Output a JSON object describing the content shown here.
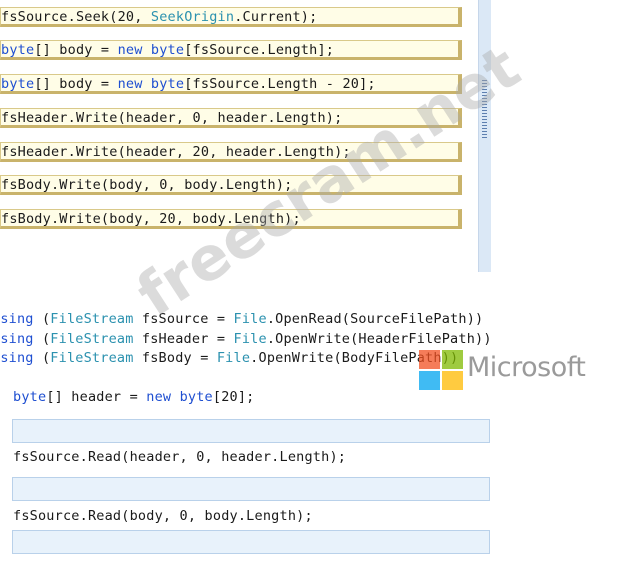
{
  "options": [
    {
      "parts": [
        [
          "t",
          "fsSource.Seek(20, "
        ],
        [
          "ty",
          "SeekOrigin"
        ],
        [
          "t",
          ".Current);"
        ]
      ]
    },
    {
      "parts": [
        [
          "kw",
          "byte"
        ],
        [
          "t",
          "[] body = "
        ],
        [
          "kw",
          "new"
        ],
        [
          "t",
          " "
        ],
        [
          "kw",
          "byte"
        ],
        [
          "t",
          "[fsSource.Length];"
        ]
      ]
    },
    {
      "parts": [
        [
          "kw",
          "byte"
        ],
        [
          "t",
          "[] body = "
        ],
        [
          "kw",
          "new"
        ],
        [
          "t",
          " "
        ],
        [
          "kw",
          "byte"
        ],
        [
          "t",
          "[fsSource.Length - 20];"
        ]
      ]
    },
    {
      "parts": [
        [
          "t",
          "fsHeader.Write(header, 0, header.Length);"
        ]
      ]
    },
    {
      "parts": [
        [
          "t",
          "fsHeader.Write(header, 20, header.Length);"
        ]
      ]
    },
    {
      "parts": [
        [
          "t",
          "fsBody.Write(body, 0, body.Length);"
        ]
      ]
    },
    {
      "parts": [
        [
          "t",
          "fsBody.Write(body, 20, body.Length);"
        ]
      ]
    }
  ],
  "code_lines": [
    {
      "parts": [
        [
          "kw",
          "using"
        ],
        [
          "t",
          " ("
        ],
        [
          "ty",
          "FileStream"
        ],
        [
          "t",
          " fsSource = "
        ],
        [
          "ty",
          "File"
        ],
        [
          "t",
          ".OpenRead(SourceFilePath))"
        ]
      ]
    },
    {
      "parts": [
        [
          "kw",
          "using"
        ],
        [
          "t",
          " ("
        ],
        [
          "ty",
          "FileStream"
        ],
        [
          "t",
          " fsHeader = "
        ],
        [
          "ty",
          "File"
        ],
        [
          "t",
          ".OpenWrite(HeaderFilePath))"
        ]
      ]
    },
    {
      "parts": [
        [
          "kw",
          "using"
        ],
        [
          "t",
          " ("
        ],
        [
          "ty",
          "FileStream"
        ],
        [
          "t",
          " fsBody = "
        ],
        [
          "ty",
          "File"
        ],
        [
          "t",
          ".OpenWrite(BodyFilePath))"
        ]
      ]
    },
    {
      "parts": [
        [
          "kw",
          "byte"
        ],
        [
          "t",
          "[] header = "
        ],
        [
          "kw",
          "new"
        ],
        [
          "t",
          " "
        ],
        [
          "kw",
          "byte"
        ],
        [
          "t",
          "[20];"
        ]
      ]
    },
    {
      "parts": [
        [
          "t",
          "fsSource.Read(header, 0, header.Length);"
        ]
      ]
    },
    {
      "parts": [
        [
          "t",
          "fsSource.Read(body, 0, body.Length);"
        ]
      ]
    }
  ],
  "watermark": "freecram.net",
  "logo_text": "Microsoft",
  "colors": {
    "keyword": "#1f4fd1",
    "type": "#2b91af",
    "tile_bg": "#fffde7",
    "drop_bg": "#e8f2fb",
    "ms_red": "#f25022",
    "ms_green": "#7fba00",
    "ms_blue": "#00a4ef",
    "ms_yellow": "#ffb900"
  }
}
